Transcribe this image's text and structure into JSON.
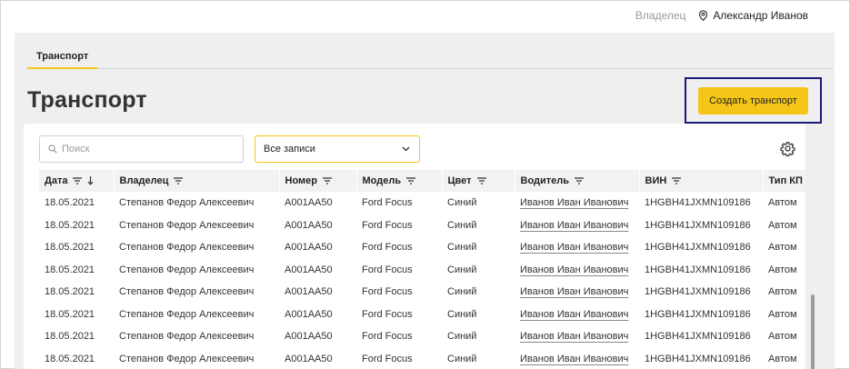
{
  "header": {
    "role_label": "Владелец",
    "user_name": "Александр Иванов"
  },
  "tabs": [
    {
      "label": "Транспорт",
      "active": true
    }
  ],
  "page": {
    "title": "Транспорт",
    "create_button": "Создать транспорт"
  },
  "search": {
    "placeholder": "Поиск",
    "value": ""
  },
  "filter": {
    "selected": "Все записи"
  },
  "colors": {
    "accent": "#f5c518",
    "highlight_border": "#1a1a7a"
  },
  "table": {
    "columns": [
      {
        "label": "Дата",
        "filter": true,
        "sort": "desc"
      },
      {
        "label": "Владелец",
        "filter": true
      },
      {
        "label": "Номер",
        "filter": true
      },
      {
        "label": "Модель",
        "filter": true
      },
      {
        "label": "Цвет",
        "filter": true
      },
      {
        "label": "Водитель",
        "filter": true
      },
      {
        "label": "ВИН",
        "filter": true
      },
      {
        "label": "Тип КП",
        "filter": false
      }
    ],
    "rows": [
      [
        "18.05.2021",
        "Степанов Федор Алексеевич",
        "A001AA50",
        "Ford Focus",
        "Синий",
        "Иванов Иван Иванович",
        "1HGBH41JXMN109186",
        "Автом"
      ],
      [
        "18.05.2021",
        "Степанов Федор Алексеевич",
        "A001AA50",
        "Ford Focus",
        "Синий",
        "Иванов Иван Иванович",
        "1HGBH41JXMN109186",
        "Автом"
      ],
      [
        "18.05.2021",
        "Степанов Федор Алексеевич",
        "A001AA50",
        "Ford Focus",
        "Синий",
        "Иванов Иван Иванович",
        "1HGBH41JXMN109186",
        "Автом"
      ],
      [
        "18.05.2021",
        "Степанов Федор Алексеевич",
        "A001AA50",
        "Ford Focus",
        "Синий",
        "Иванов Иван Иванович",
        "1HGBH41JXMN109186",
        "Автом"
      ],
      [
        "18.05.2021",
        "Степанов Федор Алексеевич",
        "A001AA50",
        "Ford Focus",
        "Синий",
        "Иванов Иван Иванович",
        "1HGBH41JXMN109186",
        "Автом"
      ],
      [
        "18.05.2021",
        "Степанов Федор Алексеевич",
        "A001AA50",
        "Ford Focus",
        "Синий",
        "Иванов Иван Иванович",
        "1HGBH41JXMN109186",
        "Автом"
      ],
      [
        "18.05.2021",
        "Степанов Федор Алексеевич",
        "A001AA50",
        "Ford Focus",
        "Синий",
        "Иванов Иван Иванович",
        "1HGBH41JXMN109186",
        "Автом"
      ],
      [
        "18.05.2021",
        "Степанов Федор Алексеевич",
        "A001AA50",
        "Ford Focus",
        "Синий",
        "Иванов Иван Иванович",
        "1HGBH41JXMN109186",
        "Автом"
      ]
    ]
  }
}
